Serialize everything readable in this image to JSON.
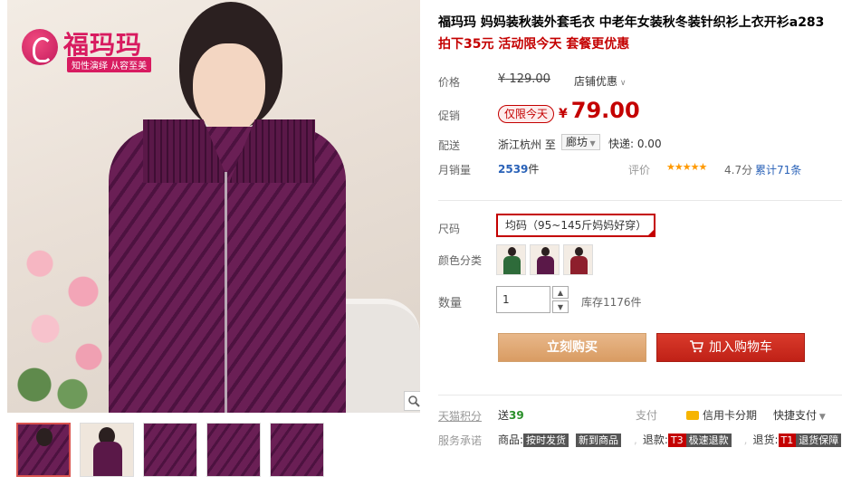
{
  "brand": {
    "logo_text": "福玛玛",
    "slogan": "知性演绎 从容至美"
  },
  "product": {
    "title": "福玛玛 妈妈装秋装外套毛衣 中老年女装秋冬装针织衫上衣开衫a283",
    "subtitle": "拍下35元 活动限今天 套餐更优惠"
  },
  "price": {
    "label": "价格",
    "currency": "¥",
    "original": "129.00",
    "store_discount": "店铺优惠"
  },
  "promo": {
    "label": "促销",
    "tag": "仅限今天",
    "currency": "¥",
    "value": "79.00"
  },
  "shipping": {
    "label": "配送",
    "from": "浙江杭州",
    "to_word": "至",
    "destination": "廊坊",
    "fee": "快递: 0.00"
  },
  "sales": {
    "label": "月销量",
    "count": "2539",
    "unit": "件",
    "rating_label": "评价",
    "stars": "★★★★★",
    "score": "4.7分",
    "reviews": "累计71条"
  },
  "options": {
    "size_label": "尺码",
    "size_value": "均码（95~145斤妈妈好穿）",
    "color_label": "颜色分类",
    "colors": [
      "#2e6b3a",
      "#5a1848",
      "#8e1f2c"
    ]
  },
  "quantity": {
    "label": "数量",
    "value": "1",
    "up": "▲",
    "down": "▼",
    "stock": "库存1176件"
  },
  "actions": {
    "buy_now": "立刻购买",
    "add_to_cart": "加入购物车"
  },
  "extras": {
    "points_label": "天猫积分",
    "points_prefix": "送",
    "points_value": "39",
    "pay_label": "支付",
    "credit": "信用卡分期",
    "quickpay": "快捷支付",
    "promise_label": "服务承诺",
    "promise_goods": "商品:",
    "tag_ontime": "按时发货",
    "tag_new": "新到商品",
    "refund_label": "退款:",
    "tag_t3": "T3",
    "tag_fast": "极速退款",
    "return_label": "退货:",
    "tag_t1": "T1",
    "tag_return": "退货保障"
  }
}
